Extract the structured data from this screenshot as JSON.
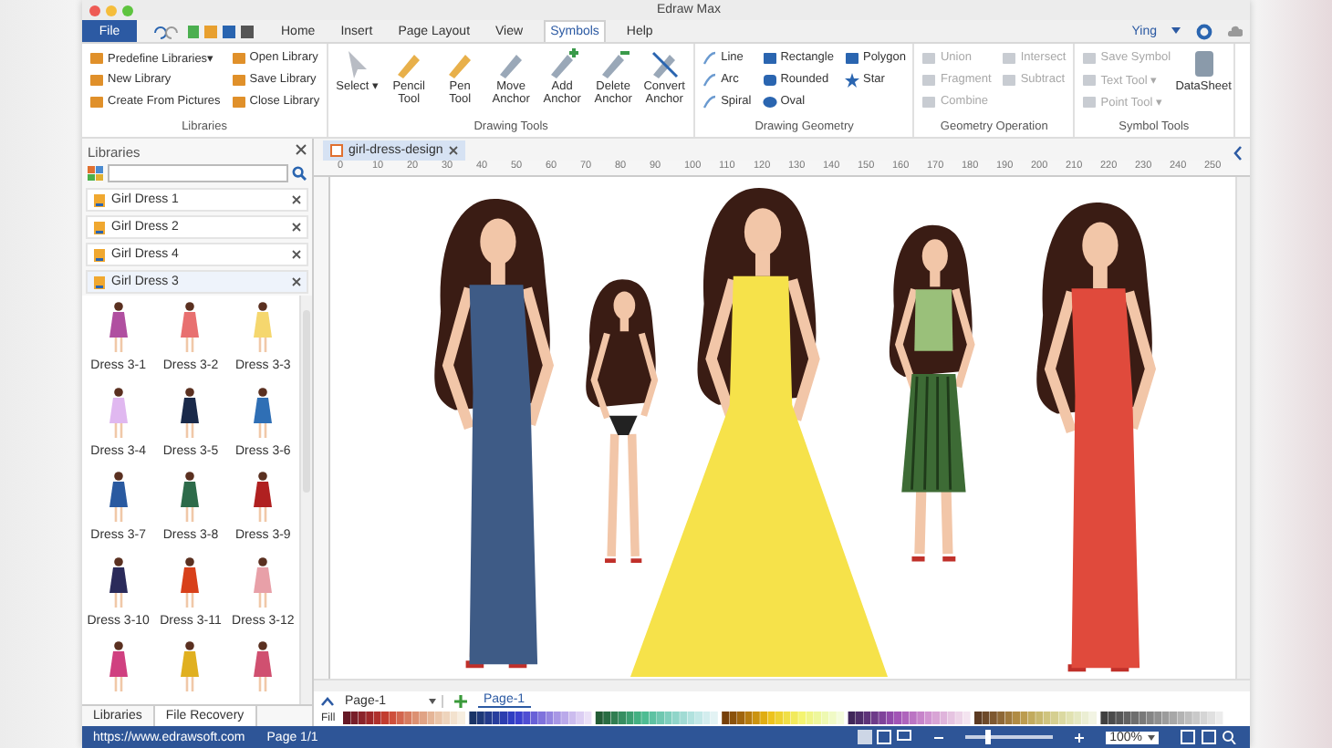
{
  "window": {
    "title": "Edraw Max"
  },
  "menu": {
    "file": "File",
    "tabs": [
      {
        "label": "Home",
        "selected": false
      },
      {
        "label": "Insert",
        "selected": false
      },
      {
        "label": "Page Layout",
        "selected": false
      },
      {
        "label": "View",
        "selected": false
      },
      {
        "label": "Symbols",
        "selected": true
      },
      {
        "label": "Help",
        "selected": false
      }
    ],
    "user": "Ying"
  },
  "ribbon": [
    {
      "kind": "grid2",
      "title": "Libraries",
      "items": [
        {
          "label": "Predefine Libraries▾",
          "disabled": false
        },
        {
          "label": "New Library",
          "disabled": false
        },
        {
          "label": "Create From Pictures",
          "disabled": false
        },
        {
          "label": "Open Library",
          "disabled": false
        },
        {
          "label": "Save Library",
          "disabled": false
        },
        {
          "label": "Close Library",
          "disabled": false
        }
      ]
    },
    {
      "kind": "big",
      "title": "Drawing Tools",
      "items": [
        {
          "label": "Select ▾",
          "disabled": false
        },
        {
          "label": "Pencil Tool",
          "disabled": false
        },
        {
          "label": "Pen Tool",
          "disabled": false
        },
        {
          "label": "Move Anchor",
          "disabled": false
        },
        {
          "label": "Add Anchor",
          "disabled": false
        },
        {
          "label": "Delete Anchor",
          "disabled": false
        },
        {
          "label": "Convert Anchor",
          "disabled": false
        }
      ]
    },
    {
      "kind": "grid3",
      "title": "Drawing Geometry",
      "items": [
        {
          "label": "Line",
          "disabled": false
        },
        {
          "label": "Arc",
          "disabled": false
        },
        {
          "label": "Spiral",
          "disabled": false
        },
        {
          "label": "Rectangle",
          "disabled": false
        },
        {
          "label": "Rounded",
          "disabled": false
        },
        {
          "label": "Oval",
          "disabled": false
        },
        {
          "label": "Polygon",
          "disabled": false
        },
        {
          "label": "Star",
          "disabled": false
        }
      ]
    },
    {
      "kind": "grid3",
      "title": "Geometry Operation",
      "items": [
        {
          "label": "Union",
          "disabled": true
        },
        {
          "label": "Fragment",
          "disabled": true
        },
        {
          "label": "Combine",
          "disabled": true
        },
        {
          "label": "Intersect",
          "disabled": true
        },
        {
          "label": "Subtract",
          "disabled": true
        }
      ]
    },
    {
      "kind": "grid3big",
      "title": "Symbol Tools",
      "items": [
        {
          "label": "Save Symbol",
          "disabled": true
        },
        {
          "label": "Text Tool ▾",
          "disabled": true
        },
        {
          "label": "Point Tool ▾",
          "disabled": true
        },
        {
          "label": "DataSheet",
          "disabled": false
        }
      ]
    }
  ],
  "libraries": {
    "title": "Libraries",
    "groups": [
      {
        "label": "Girl Dress 1",
        "expanded": false
      },
      {
        "label": "Girl Dress 2",
        "expanded": false
      },
      {
        "label": "Girl Dress 4",
        "expanded": false
      },
      {
        "label": "Girl Dress 3",
        "expanded": true
      }
    ],
    "shapes": [
      {
        "label": "Dress 3-1",
        "color": "#b04fa0"
      },
      {
        "label": "Dress 3-2",
        "color": "#e87070"
      },
      {
        "label": "Dress 3-3",
        "color": "#f5d76e"
      },
      {
        "label": "Dress 3-4",
        "color": "#e0b8f0"
      },
      {
        "label": "Dress 3-5",
        "color": "#1a2a4a"
      },
      {
        "label": "Dress 3-6",
        "color": "#2f6fb5"
      },
      {
        "label": "Dress 3-7",
        "color": "#2a5aa0"
      },
      {
        "label": "Dress 3-8",
        "color": "#2d6b4a"
      },
      {
        "label": "Dress 3-9",
        "color": "#b02020"
      },
      {
        "label": "Dress 3-10",
        "color": "#2a2a5a"
      },
      {
        "label": "Dress 3-11",
        "color": "#d8401a"
      },
      {
        "label": "Dress 3-12",
        "color": "#e8a0a8"
      },
      {
        "color": "#d04080"
      },
      {
        "color": "#e0b020"
      },
      {
        "color": "#d05070"
      }
    ],
    "bottom_tabs": [
      {
        "label": "Libraries",
        "selected": false
      },
      {
        "label": "File Recovery",
        "selected": true
      }
    ]
  },
  "document": {
    "tab": "girl-dress-design",
    "ruler": [
      "0",
      "10",
      "20",
      "30",
      "40",
      "50",
      "60",
      "70",
      "80",
      "90",
      "100",
      "110",
      "120",
      "130",
      "140",
      "150",
      "160",
      "170",
      "180",
      "190",
      "200",
      "210",
      "220",
      "230",
      "240",
      "250"
    ]
  },
  "pages": {
    "dropdown": "Page-1",
    "tabs": [
      {
        "label": "Page-1",
        "selected": true
      }
    ]
  },
  "palette": {
    "label": "Fill"
  },
  "status_bar": {
    "url": "https://www.edrawsoft.com",
    "page": "Page 1/1",
    "zoom": {
      "level": 0.25,
      "value": "100%"
    }
  }
}
